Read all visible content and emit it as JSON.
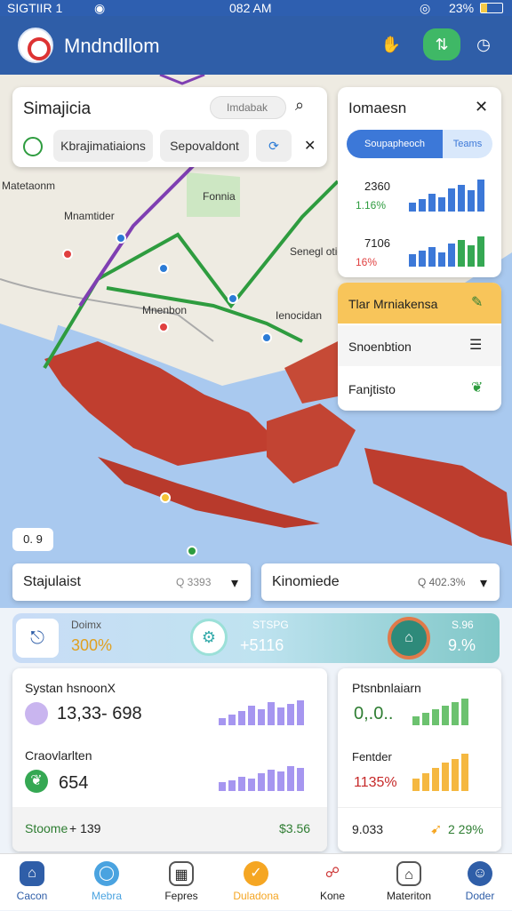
{
  "status": {
    "carrier": "SIGTIIR 1",
    "time": "082 AM",
    "battery": "23%"
  },
  "app": {
    "title": "Mndndllom"
  },
  "search": {
    "title": "Simajicia",
    "placeholder": "Imdabak",
    "chip1": "Kbrajimatiaions",
    "chip2": "Sepovaldont"
  },
  "info_panel": {
    "title": "Iomaesn",
    "tab_active": "Soupapheoch",
    "tab_other": "Teams",
    "stat1_value": "2360",
    "stat1_sub": "1.16%",
    "stat2_value": "7106",
    "stat2_sub": "16%",
    "menu1": "Tlar Mrniakensa",
    "menu2": "Snoenbtion",
    "menu3": "Fanjtisto"
  },
  "map_labels": {
    "l1": "Matetaonm",
    "l2": "Mnamtider",
    "l3": "Fonnia",
    "l4": "Senegl otic",
    "l5": "Mnenbon",
    "l6": "Ienocidan",
    "zoom": "0. 9"
  },
  "filters": {
    "f1_label": "Stajulaist",
    "f1_value": "Q 3393",
    "f2_label": "Kinomiede",
    "f2_value": "Q 402.3%"
  },
  "summary": {
    "s1_label": "Doimx",
    "s1_value": "300%",
    "s2_label": "STSPG",
    "s2_value": "+5116",
    "s3_label": "S.96",
    "s3_value": "9.%"
  },
  "stats_left": {
    "title": "Systan hsnoonX",
    "value1": "13,33- 698",
    "label2": "Craovlarlten",
    "value2": "654",
    "footer_label": "Stoome",
    "footer_value": "+ 139",
    "footer_right": "$3.56"
  },
  "stats_right": {
    "title": "Ptsnbnlaiarn",
    "value1": "0,.0..",
    "label2": "Fentder",
    "value2": "1135%",
    "footer_value": "9.033",
    "footer_right": "2 29%"
  },
  "nav": [
    "Cacon",
    "Mebra",
    "Fepres",
    "Duladona",
    "Kone",
    "Materiton",
    "Doder"
  ],
  "colors": {
    "primary": "#2f5ea8",
    "accent_orange": "#f5b841",
    "green": "#35a853"
  }
}
